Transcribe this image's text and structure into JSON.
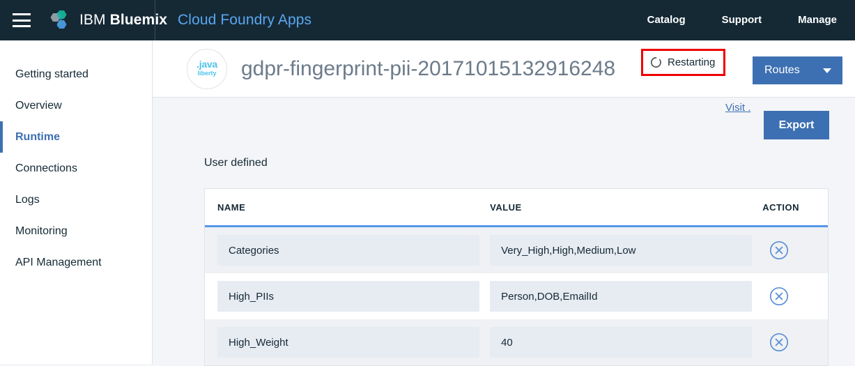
{
  "topnav": {
    "menu_icon": "hamburger-menu-icon",
    "logo_icon": "bluemix-logo-icon",
    "brand_ibm": "IBM",
    "brand_bluemix": "Bluemix",
    "brand_sub": "Cloud Foundry Apps",
    "links": [
      {
        "label": "Catalog"
      },
      {
        "label": "Support"
      },
      {
        "label": "Manage"
      }
    ]
  },
  "sidebar": {
    "items": [
      {
        "label": "Getting started",
        "active": false
      },
      {
        "label": "Overview",
        "active": false
      },
      {
        "label": "Runtime",
        "active": true
      },
      {
        "label": "Connections",
        "active": false
      },
      {
        "label": "Logs",
        "active": false
      },
      {
        "label": "Monitoring",
        "active": false
      },
      {
        "label": "API Management",
        "active": false
      }
    ]
  },
  "app_header": {
    "runtime_icon": "java-liberty-icon",
    "runtime_icon_text_top": ".java",
    "runtime_icon_text_bottom": "liberty",
    "title": "gdpr-fingerprint-pii-20171015132916248",
    "status_icon": "restarting-spinner-icon",
    "status_label": "Restarting",
    "status_highlight_color": "#ee0000",
    "visit_label": "Visit .",
    "routes_label": "Routes",
    "routes_caret_icon": "chevron-down-icon"
  },
  "content": {
    "export_label": "Export",
    "section_title": "User defined",
    "table": {
      "columns": [
        "NAME",
        "VALUE",
        "ACTION"
      ],
      "rows": [
        {
          "name": "Categories",
          "value": "Very_High,High,Medium,Low",
          "action_icon": "delete-circle-x-icon"
        },
        {
          "name": "High_PIIs",
          "value": "Person,DOB,EmailId",
          "action_icon": "delete-circle-x-icon"
        },
        {
          "name": "High_Weight",
          "value": "40",
          "action_icon": "delete-circle-x-icon"
        }
      ]
    }
  },
  "colors": {
    "nav_background": "#152935",
    "accent_blue": "#3d70b2",
    "link_blue": "#5aa7f0",
    "page_background": "#f3f5f8",
    "table_header_rule": "#5596e6",
    "field_background": "#e7ebf2",
    "alert_red": "#ee0000"
  }
}
